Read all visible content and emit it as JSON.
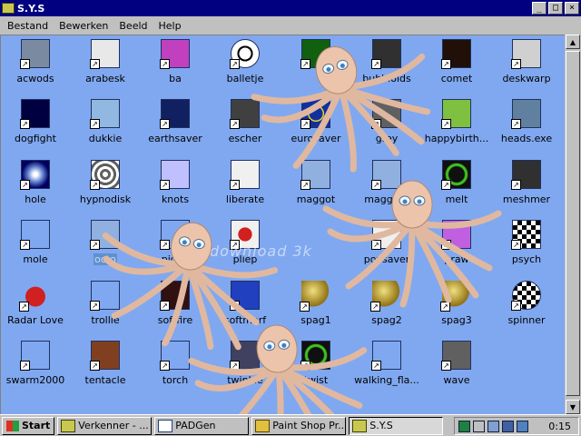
{
  "window": {
    "title": "S.Y.S",
    "buttons": {
      "minimize": "_",
      "maximize": "□",
      "close": "×"
    }
  },
  "menu": [
    "Bestand",
    "Bewerken",
    "Beeld",
    "Help"
  ],
  "files": [
    {
      "label": "acwods",
      "icon": "screensaver-gray-tile",
      "color": "#7a8aa0"
    },
    {
      "label": "arabesk",
      "icon": "web-pattern",
      "color": "#e8e8e8"
    },
    {
      "label": "ba",
      "icon": "ba-letters",
      "color": "#c040c0"
    },
    {
      "label": "balletje",
      "icon": "soccer-ball",
      "color": "#f0f0f0"
    },
    {
      "label": "",
      "icon": "green-sprite",
      "color": "#106010"
    },
    {
      "label": "bubbloids",
      "icon": "bubbles",
      "color": "#303030"
    },
    {
      "label": "comet",
      "icon": "comet",
      "color": "#201008"
    },
    {
      "label": "deskwarp",
      "icon": "warp-grid",
      "color": "#d0d0d0"
    },
    {
      "label": "dogfight",
      "icon": "planes",
      "color": "#000040"
    },
    {
      "label": "dukkie",
      "icon": "duck",
      "color": "#90b8e0"
    },
    {
      "label": "earthsaver",
      "icon": "earth",
      "color": "#102060"
    },
    {
      "label": "escher",
      "icon": "escher-face",
      "color": "#404040"
    },
    {
      "label": "eurosaver",
      "icon": "eu-flag",
      "color": "#1030a0"
    },
    {
      "label": "grey",
      "icon": "grey-ab",
      "color": "#606060"
    },
    {
      "label": "happybirth...",
      "icon": "flower",
      "color": "#80c040"
    },
    {
      "label": "heads.exe",
      "icon": "heads",
      "color": "#6080a0"
    },
    {
      "label": "hole",
      "icon": "hole",
      "color": "#000060"
    },
    {
      "label": "hypnodisk",
      "icon": "spiral",
      "color": "#808080"
    },
    {
      "label": "knots",
      "icon": "knot",
      "color": "#c0c0ff"
    },
    {
      "label": "liberate",
      "icon": "liberate",
      "color": "#f0f0f0"
    },
    {
      "label": "maggot",
      "icon": "maggot",
      "color": "#90b0e0"
    },
    {
      "label": "maggot2",
      "icon": "maggot",
      "color": "#90b0e0"
    },
    {
      "label": "melt",
      "icon": "green-ring",
      "color": "#101010"
    },
    {
      "label": "meshmer",
      "icon": "mesh",
      "color": "#303030"
    },
    {
      "label": "mole",
      "icon": "mole",
      "color": "#80a8f0"
    },
    {
      "label": "octo",
      "icon": "octopus",
      "color": "#90b0e0"
    },
    {
      "label": "piggy",
      "icon": "piggy",
      "color": "#80a8f0"
    },
    {
      "label": "pliep",
      "icon": "red-dot",
      "color": "#f0f0f0"
    },
    {
      "label": "",
      "icon": "blank",
      "color": "#80a8f0"
    },
    {
      "label": "povsaver",
      "icon": "pov",
      "color": "#f0f0f0"
    },
    {
      "label": "praw",
      "icon": "praw",
      "color": "#c060e0"
    },
    {
      "label": "psych",
      "icon": "checker",
      "color": "#000000"
    },
    {
      "label": "Radar Love",
      "icon": "heart",
      "color": "#c02020"
    },
    {
      "label": "trollie",
      "icon": "trollie",
      "color": "#80a8f0"
    },
    {
      "label": "softfire",
      "icon": "fire-f",
      "color": "#301010"
    },
    {
      "label": "softmorf",
      "icon": "soft-globe",
      "color": "#2040c0"
    },
    {
      "label": "spag1",
      "icon": "sphere",
      "color": "#b09020"
    },
    {
      "label": "spag2",
      "icon": "sphere",
      "color": "#b09020"
    },
    {
      "label": "spag3",
      "icon": "sphere",
      "color": "#b09020"
    },
    {
      "label": "spinner",
      "icon": "checker-round",
      "color": "#000000"
    },
    {
      "label": "swarm2000",
      "icon": "bee",
      "color": "#80a8f0"
    },
    {
      "label": "tentacle",
      "icon": "tentacle",
      "color": "#804020"
    },
    {
      "label": "torch",
      "icon": "torch",
      "color": "#80a8f0"
    },
    {
      "label": "twinkle",
      "icon": "grid",
      "color": "#404060"
    },
    {
      "label": "twist",
      "icon": "green-ring",
      "color": "#101010"
    },
    {
      "label": "walking_fla...",
      "icon": "flame",
      "color": "#80a8f0"
    },
    {
      "label": "wave",
      "icon": "wave",
      "color": "#606060"
    }
  ],
  "watermark": "download 3k",
  "taskbar": {
    "start": "Start",
    "tasks": [
      "Verkenner - ...",
      "PADGen",
      "Paint Shop Pr...",
      "S.Y.S"
    ],
    "clock": "0:15"
  }
}
